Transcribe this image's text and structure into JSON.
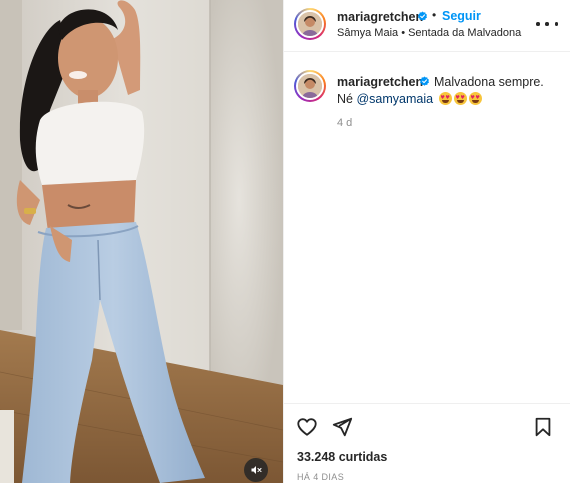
{
  "post": {
    "username": "mariagretchen",
    "follow_label": "Seguir",
    "separator": "•",
    "audio": "Sâmya Maia • Sentada da Malvadona",
    "caption": {
      "username": "mariagretchen",
      "text_line1": "Malvadona sempre.",
      "text_line2_prefix": "Né ",
      "mention": "@samyamaia",
      "emoji_count": 3,
      "time": "4 d"
    },
    "likes": "33.248 curtidas",
    "date": "HÁ 4 DIAS"
  },
  "icons": {
    "verified": "verified-badge-icon",
    "more": "more-options-icon",
    "like": "heart-icon",
    "share": "paper-plane-icon",
    "save": "bookmark-icon",
    "mute": "muted-speaker-icon"
  },
  "colors": {
    "accent": "#0095f6",
    "verified": "#0095f6",
    "text": "#262626",
    "muted": "#8e8e8e",
    "mention": "#00376b",
    "divider": "#efefef"
  }
}
